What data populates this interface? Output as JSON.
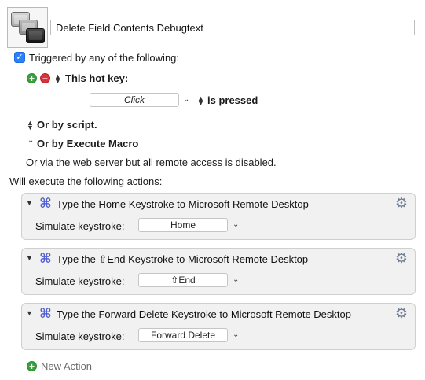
{
  "macro": {
    "icon_name": "remote-desktop-monitors-icon",
    "name": "Delete Field Contents Debugtext"
  },
  "trigger": {
    "checked": true,
    "heading": "Triggered by any of the following:",
    "hotkey_label": "This hot key:",
    "hotkey_value": "Click",
    "hotkey_condition": "is pressed",
    "or_script": "Or by script.",
    "or_execute_macro": "Or by Execute Macro",
    "web_server_note": "Or via the web server but all remote access is disabled."
  },
  "actions_heading": "Will execute the following actions:",
  "actions": [
    {
      "title": "Type the Home Keystroke to Microsoft Remote Desktop",
      "sim_label": "Simulate keystroke:",
      "key": "Home"
    },
    {
      "title": "Type the ⇧End Keystroke to Microsoft Remote Desktop",
      "sim_label": "Simulate keystroke:",
      "key": "⇧End"
    },
    {
      "title": "Type the Forward Delete Keystroke to Microsoft Remote Desktop",
      "sim_label": "Simulate keystroke:",
      "key": "Forward Delete"
    }
  ],
  "new_action_label": "New Action",
  "colors": {
    "accent": "#2f7ff6",
    "add_green": "#37a23c",
    "remove_red": "#d6333b",
    "command_icon": "#5260d0"
  }
}
